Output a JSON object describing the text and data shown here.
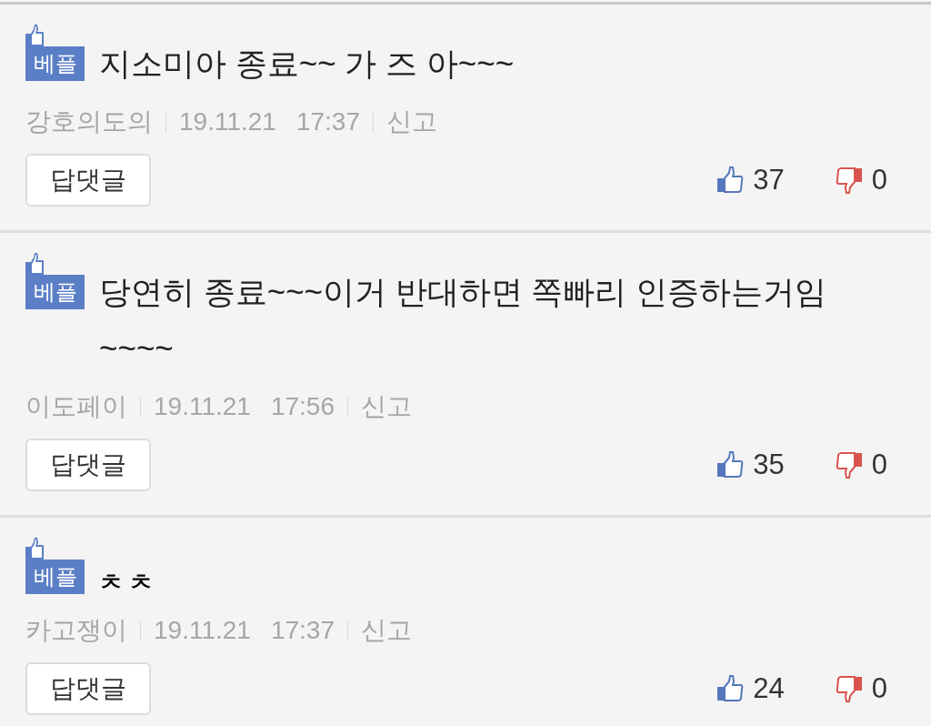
{
  "comments": [
    {
      "badge": "베플",
      "text": "지소미아 종료~~ 가 즈 아~~~",
      "bold": false,
      "author": "강호의도의",
      "date": "19.11.21",
      "time": "17:37",
      "report": "신고",
      "reply": "답댓글",
      "likes": "37",
      "dislikes": "0"
    },
    {
      "badge": "베플",
      "text": "당연히 종료~~~이거 반대하면 쪽빠리 인증하는거임 ~~~~",
      "bold": false,
      "author": "이도페이",
      "date": "19.11.21",
      "time": "17:56",
      "report": "신고",
      "reply": "답댓글",
      "likes": "35",
      "dislikes": "0"
    },
    {
      "badge": "베플",
      "text": "ㅊ ㅊ",
      "bold": true,
      "author": "카고쟁이",
      "date": "19.11.21",
      "time": "17:37",
      "report": "신고",
      "reply": "답댓글",
      "likes": "24",
      "dislikes": "0"
    }
  ]
}
